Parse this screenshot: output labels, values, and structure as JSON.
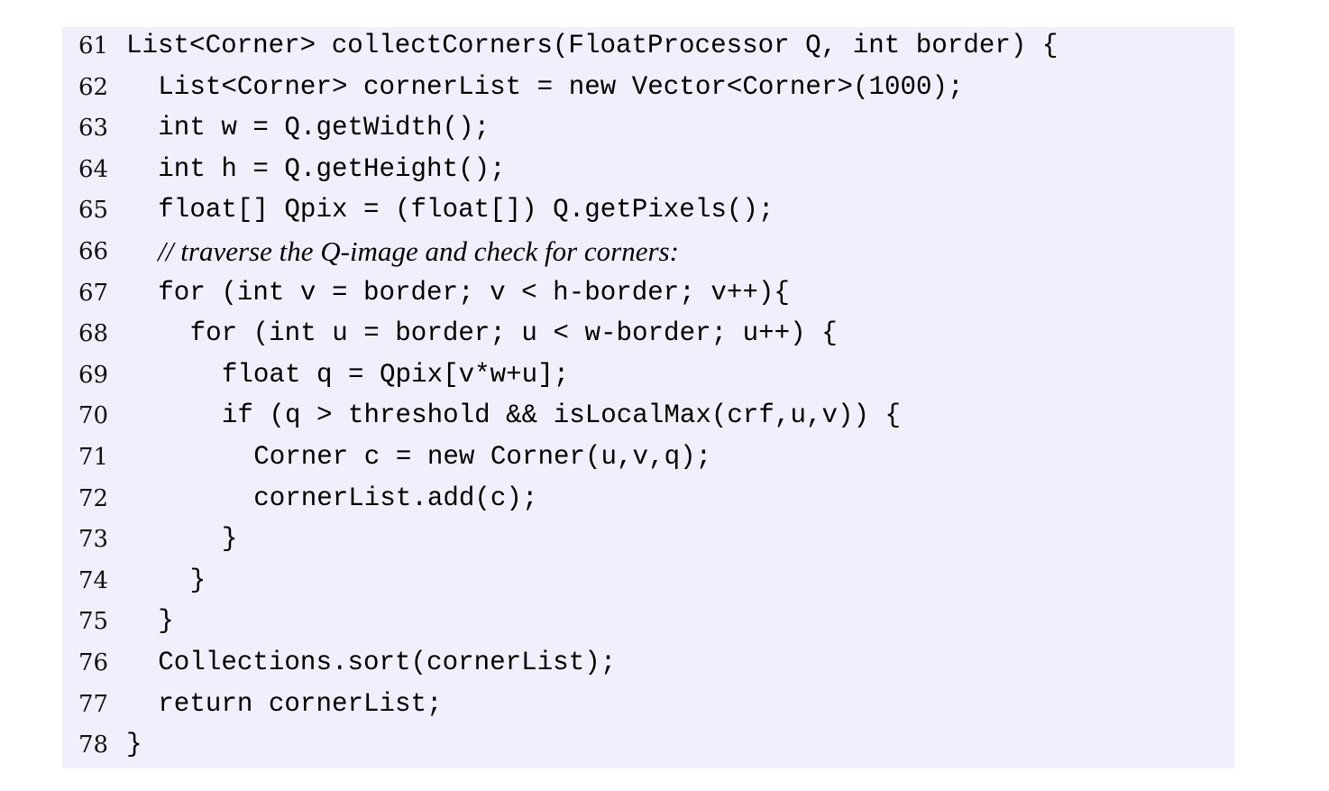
{
  "listing": {
    "lines": [
      {
        "num": "61",
        "text": "List<Corner> collectCorners(FloatProcessor Q, int border) {",
        "indent": 0,
        "comment": false
      },
      {
        "num": "62",
        "text": "List<Corner> cornerList = new Vector<Corner>(1000);",
        "indent": 1,
        "comment": false
      },
      {
        "num": "63",
        "text": "int w = Q.getWidth();",
        "indent": 1,
        "comment": false
      },
      {
        "num": "64",
        "text": "int h = Q.getHeight();",
        "indent": 1,
        "comment": false
      },
      {
        "num": "65",
        "text": "float[] Qpix = (float[]) Q.getPixels();",
        "indent": 1,
        "comment": false
      },
      {
        "num": "66",
        "text": "// traverse the Q-image and check for corners:",
        "indent": 1,
        "comment": true
      },
      {
        "num": "67",
        "text": "for (int v = border; v < h-border; v++){",
        "indent": 1,
        "comment": false
      },
      {
        "num": "68",
        "text": "for (int u = border; u < w-border; u++) {",
        "indent": 2,
        "comment": false
      },
      {
        "num": "69",
        "text": "float q = Qpix[v*w+u];",
        "indent": 3,
        "comment": false
      },
      {
        "num": "70",
        "text": "if (q > threshold && isLocalMax(crf,u,v)) {",
        "indent": 3,
        "comment": false
      },
      {
        "num": "71",
        "text": "Corner c = new Corner(u,v,q);",
        "indent": 4,
        "comment": false
      },
      {
        "num": "72",
        "text": "cornerList.add(c);",
        "indent": 4,
        "comment": false
      },
      {
        "num": "73",
        "text": "}",
        "indent": 3,
        "comment": false
      },
      {
        "num": "74",
        "text": "}",
        "indent": 2,
        "comment": false
      },
      {
        "num": "75",
        "text": "}",
        "indent": 1,
        "comment": false
      },
      {
        "num": "76",
        "text": "Collections.sort(cornerList);",
        "indent": 1,
        "comment": false
      },
      {
        "num": "77",
        "text": "return cornerList;",
        "indent": 1,
        "comment": false
      },
      {
        "num": "78",
        "text": "}",
        "indent": 0,
        "comment": false
      }
    ]
  }
}
